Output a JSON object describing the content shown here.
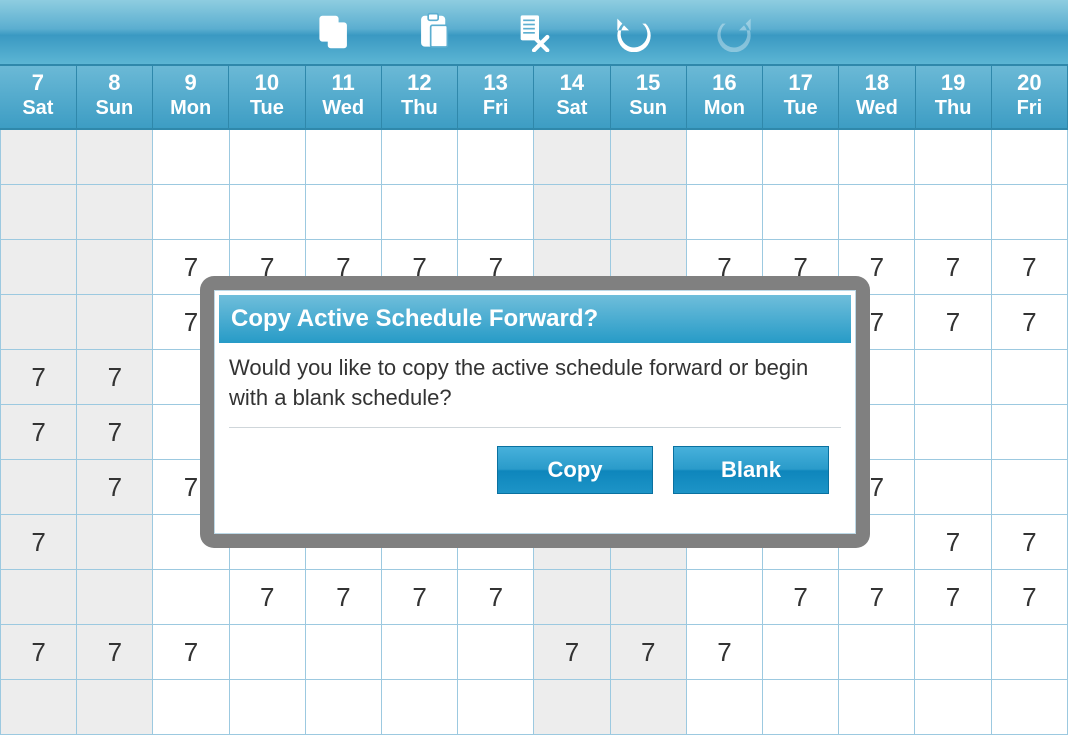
{
  "toolbar": {
    "icons": [
      "copy-icon",
      "paste-icon",
      "delete-icon",
      "undo-icon",
      "redo-icon"
    ],
    "redo_disabled": true
  },
  "columns": [
    {
      "num": "7",
      "name": "Sat",
      "weekend": true
    },
    {
      "num": "8",
      "name": "Sun",
      "weekend": true
    },
    {
      "num": "9",
      "name": "Mon",
      "weekend": false
    },
    {
      "num": "10",
      "name": "Tue",
      "weekend": false
    },
    {
      "num": "11",
      "name": "Wed",
      "weekend": false
    },
    {
      "num": "12",
      "name": "Thu",
      "weekend": false
    },
    {
      "num": "13",
      "name": "Fri",
      "weekend": false
    },
    {
      "num": "14",
      "name": "Sat",
      "weekend": true
    },
    {
      "num": "15",
      "name": "Sun",
      "weekend": true
    },
    {
      "num": "16",
      "name": "Mon",
      "weekend": false
    },
    {
      "num": "17",
      "name": "Tue",
      "weekend": false
    },
    {
      "num": "18",
      "name": "Wed",
      "weekend": false
    },
    {
      "num": "19",
      "name": "Thu",
      "weekend": false
    },
    {
      "num": "20",
      "name": "Fri",
      "weekend": false
    }
  ],
  "cell_value": "7",
  "rows": [
    [
      "",
      "",
      "",
      "",
      "",
      "",
      "",
      "",
      "",
      "",
      "",
      "",
      "",
      ""
    ],
    [
      "",
      "",
      "",
      "",
      "",
      "",
      "",
      "",
      "",
      "",
      "",
      "",
      "",
      ""
    ],
    [
      "",
      "",
      "7",
      "7",
      "7",
      "7",
      "7",
      "",
      "",
      "7",
      "7",
      "7",
      "7",
      "7"
    ],
    [
      "",
      "",
      "7",
      "",
      "",
      "",
      "",
      "",
      "",
      "",
      "",
      "7",
      "7",
      "7"
    ],
    [
      "7",
      "7",
      "",
      "",
      "",
      "",
      "",
      "",
      "",
      "",
      "",
      "",
      "",
      ""
    ],
    [
      "7",
      "7",
      "",
      "",
      "",
      "",
      "",
      "",
      "",
      "",
      "",
      "",
      "",
      ""
    ],
    [
      "",
      "7",
      "7",
      "",
      "",
      "",
      "",
      "",
      "",
      "",
      "",
      "7",
      "",
      ""
    ],
    [
      "7",
      "",
      "",
      "",
      "",
      "",
      "",
      "",
      "",
      "",
      "",
      "",
      "7",
      "7"
    ],
    [
      "",
      "",
      "",
      "7",
      "7",
      "7",
      "7",
      "",
      "",
      "",
      "7",
      "7",
      "7",
      "7"
    ],
    [
      "7",
      "7",
      "7",
      "",
      "",
      "",
      "",
      "7",
      "7",
      "7",
      "",
      "",
      "",
      ""
    ],
    [
      "",
      "",
      "",
      "",
      "",
      "",
      "",
      "",
      "",
      "",
      "",
      "",
      "",
      ""
    ]
  ],
  "dialog": {
    "title": "Copy Active Schedule Forward?",
    "body": "Would you like to copy the active schedule forward or begin with a blank schedule?",
    "copy_label": "Copy",
    "blank_label": "Blank"
  }
}
